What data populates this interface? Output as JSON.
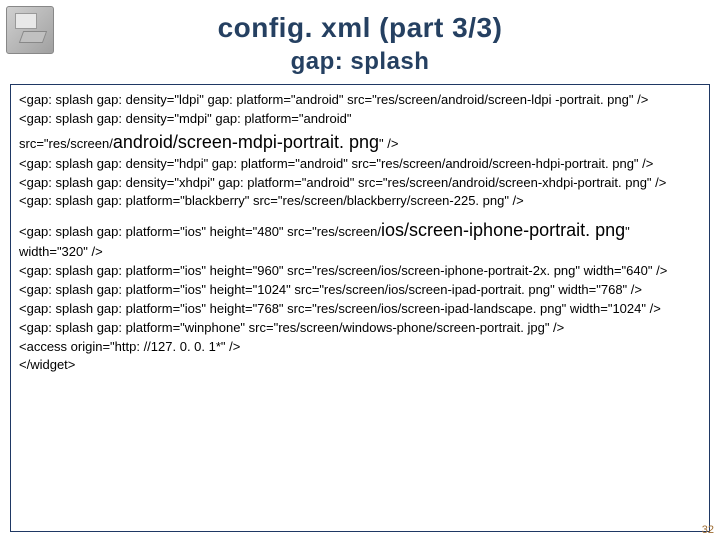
{
  "header": {
    "title": "config. xml (part 3/3)",
    "subtitle": "gap: splash"
  },
  "code": {
    "l1": "    <gap: splash gap: density=\"ldpi\" gap: platform=\"android\" src=\"res/screen/android/screen-ldpi -portrait. png\" />",
    "l2": "    <gap: splash gap: density=\"mdpi\" gap: platform=\"android\"",
    "l2b_pre": "src=\"res/screen/",
    "l2b_em": "android/screen-mdpi-portrait. png",
    "l2b_post": "\" />",
    "l3": "    <gap: splash gap: density=\"hdpi\" gap: platform=\"android\" src=\"res/screen/android/screen-hdpi-portrait. png\" />",
    "l4": "    <gap: splash gap: density=\"xhdpi\" gap: platform=\"android\" src=\"res/screen/android/screen-xhdpi-portrait. png\" />",
    "l5": "    <gap: splash gap: platform=\"blackberry\" src=\"res/screen/blackberry/screen-225. png\" />",
    "l6_pre": "    <gap: splash gap: platform=\"ios\" height=\"480\" src=\"res/screen/",
    "l6_em": "ios/screen-iphone-portrait. png",
    "l6_post": "\" width=\"320\" />",
    "l7": "    <gap: splash gap: platform=\"ios\" height=\"960\" src=\"res/screen/ios/screen-iphone-portrait-2x. png\" width=\"640\" />",
    "l8": "    <gap: splash gap: platform=\"ios\" height=\"1024\" src=\"res/screen/ios/screen-ipad-portrait. png\" width=\"768\" />",
    "l9": "    <gap: splash gap: platform=\"ios\" height=\"768\" src=\"res/screen/ios/screen-ipad-landscape. png\" width=\"1024\" />",
    "l10": "    <gap: splash gap: platform=\"winphone\" src=\"res/screen/windows-phone/screen-portrait. jpg\" />",
    "l11": "    <access origin=\"http: //127. 0. 0. 1*\" />",
    "l12": "</widget>"
  },
  "page_number": "32"
}
